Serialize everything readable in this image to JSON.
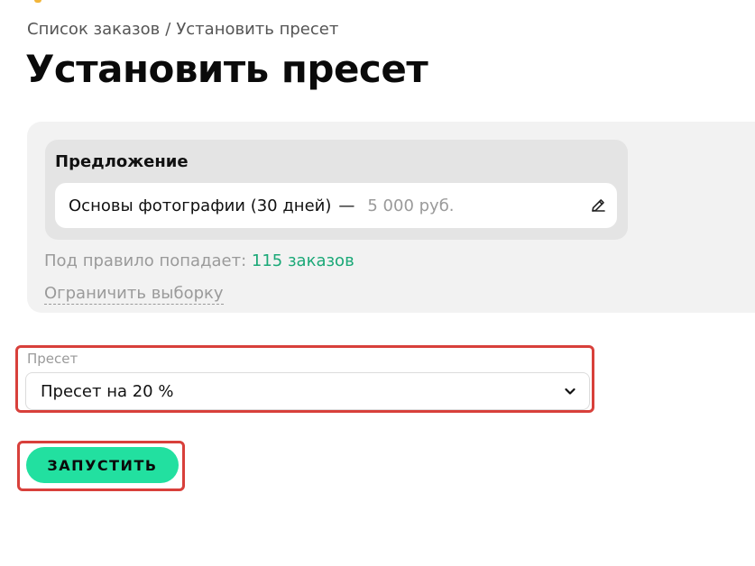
{
  "breadcrumb": {
    "items": [
      {
        "label": "Список заказов"
      },
      {
        "label": "Установить пресет"
      }
    ],
    "separator": "/"
  },
  "page": {
    "title": "Установить пресет"
  },
  "offer": {
    "label": "Предложение",
    "name": "Основы фотографии (30 дней)",
    "dash": "—",
    "price": "5 000 руб.",
    "edit_icon": "pencil-icon"
  },
  "match": {
    "prefix": "Под правило попадает:",
    "count": "115 заказов"
  },
  "limit_link": "Ограничить выборку",
  "preset": {
    "label": "Пресет",
    "selected": "Пресет на 20 %",
    "icon": "chevron-down-icon"
  },
  "run_button": {
    "label": "ЗАПУСТИТЬ"
  },
  "colors": {
    "accent_green": "#22e0a0",
    "count_green": "#1aa877",
    "highlight_red": "#d8403b",
    "top_mark": "#f2b53a"
  }
}
